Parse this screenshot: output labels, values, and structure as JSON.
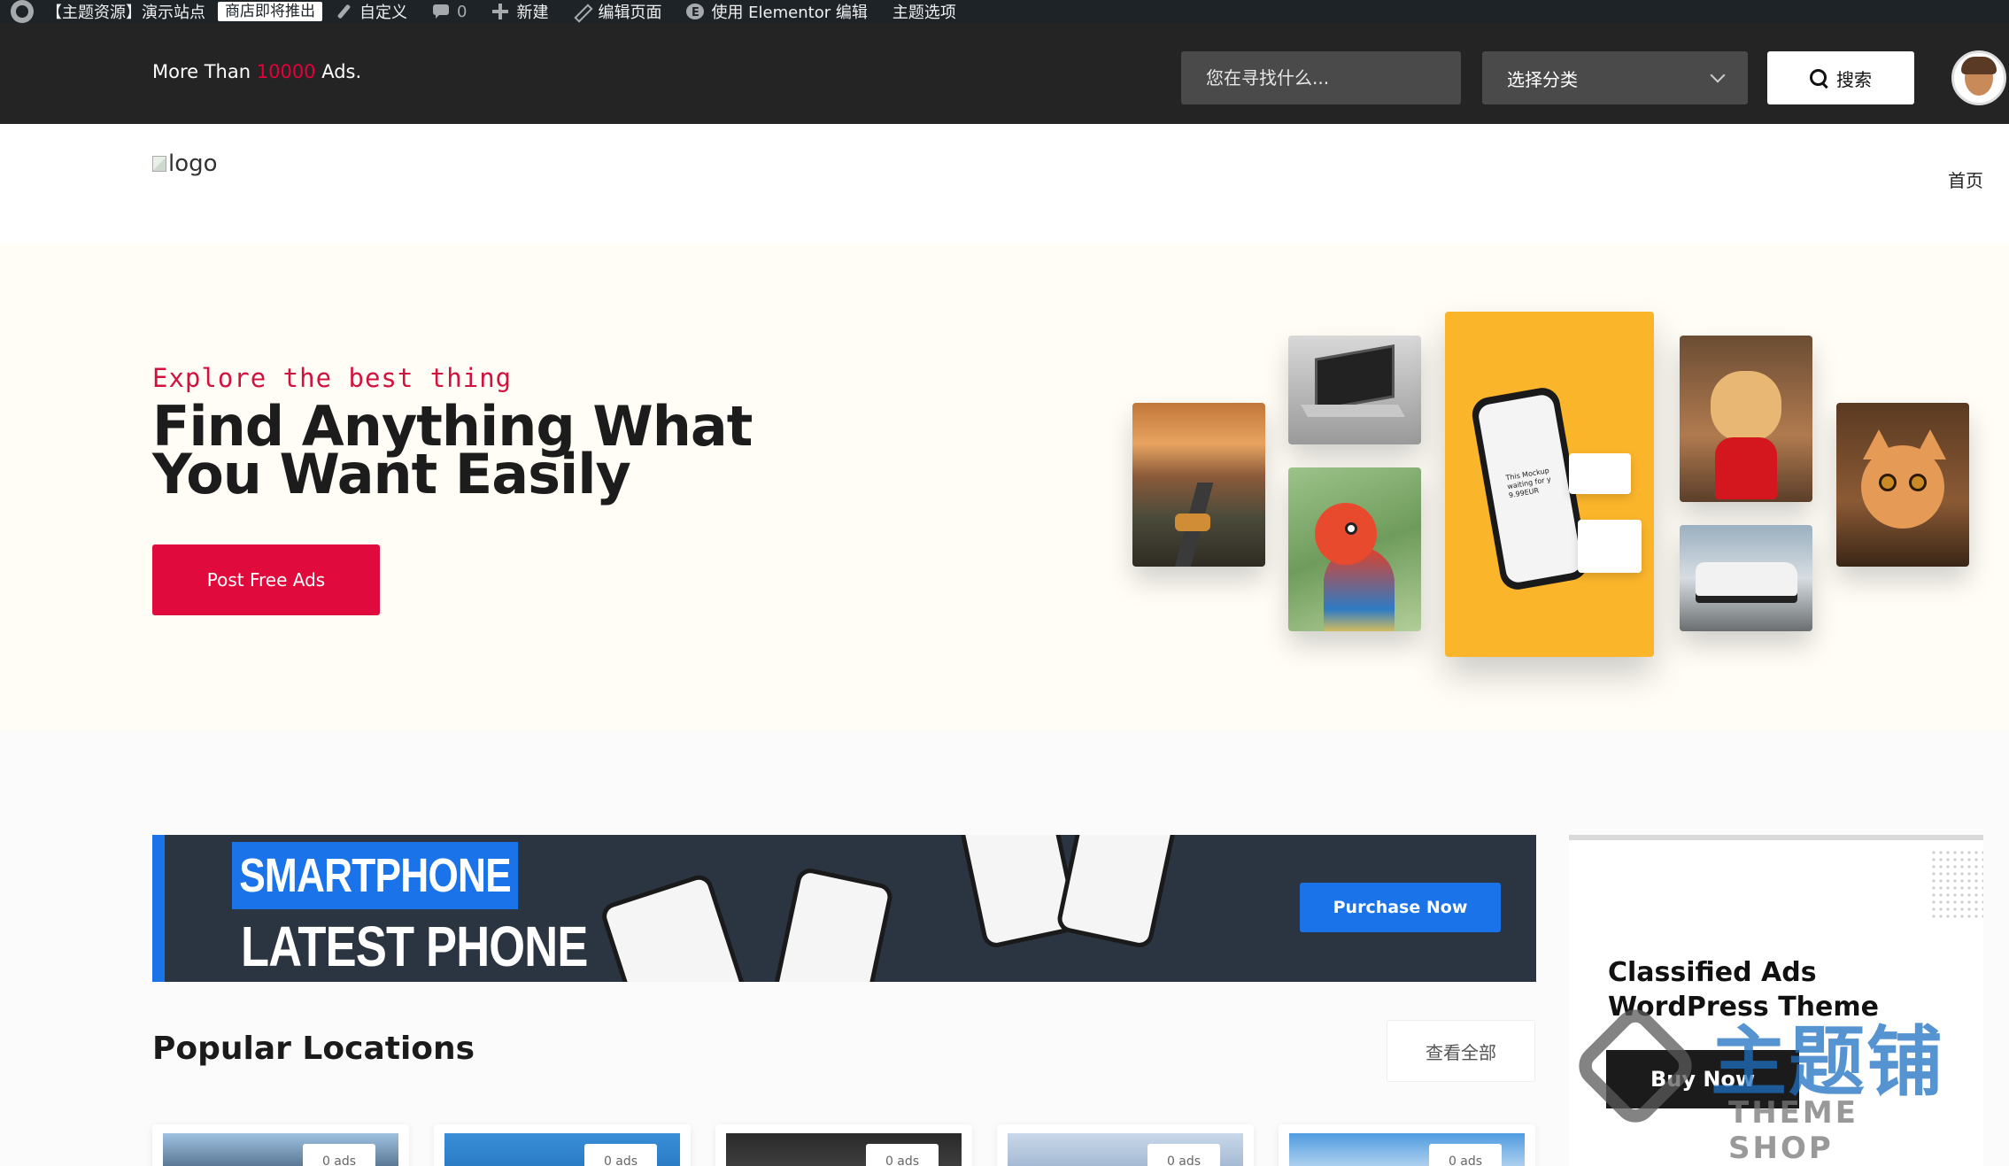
{
  "admin_bar": {
    "site_name": "【主题资源】演示站点",
    "store_notice": "商店即将推出",
    "customize": "自定义",
    "comments_count": "0",
    "new": "新建",
    "edit_page": "编辑页面",
    "elementor_edit": "使用 Elementor 编辑",
    "theme_options": "主题选项"
  },
  "header": {
    "tagline_prefix": "More Than ",
    "tagline_count": "10000",
    "tagline_suffix": " Ads.",
    "search_placeholder": "您在寻找什么...",
    "category_select": "选择分类",
    "search_button": "搜索",
    "highlight_color": "#e6003a"
  },
  "nav": {
    "logo_alt": "logo",
    "home": "首页"
  },
  "hero": {
    "kicker": "Explore the best thing",
    "title": "Find Anything What You Want Easily",
    "cta": "Post Free Ads",
    "phone_mockup_text": "This Mockup waiting for y 9.99EUR"
  },
  "banner": {
    "line1": "SMARTPHONE",
    "line2": "LATEST PHONE",
    "cta": "Purchase Now",
    "accent": "#1a73e8"
  },
  "side_ad": {
    "title": "Classified Ads WordPress Theme",
    "cta": "Buy Now",
    "watermark_main": "主题铺",
    "watermark_sub": "THEME SHOP"
  },
  "locations": {
    "title": "Popular Locations",
    "view_all": "查看全部",
    "cards": [
      {
        "badge": "0 ads"
      },
      {
        "badge": "0 ads"
      },
      {
        "badge": "0 ads"
      },
      {
        "badge": "0 ads"
      },
      {
        "badge": "0 ads"
      }
    ]
  }
}
